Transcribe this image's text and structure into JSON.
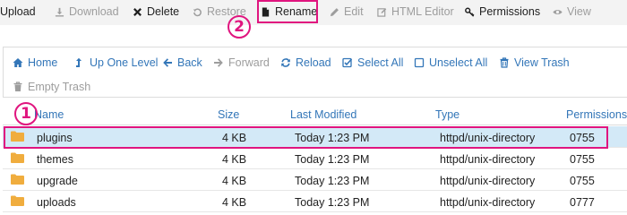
{
  "toolbar": {
    "upload": "Upload",
    "download": "Download",
    "delete": "Delete",
    "restore": "Restore",
    "rename": "Rename",
    "edit": "Edit",
    "html_editor": "HTML Editor",
    "permissions": "Permissions",
    "view": "View"
  },
  "nav": {
    "home": "Home",
    "up_one_level": "Up One Level",
    "back": "Back",
    "forward": "Forward",
    "reload": "Reload",
    "select_all": "Select All",
    "unselect_all": "Unselect All",
    "view_trash": "View Trash",
    "empty_trash": "Empty Trash"
  },
  "callouts": {
    "one": "1",
    "two": "2"
  },
  "table": {
    "headers": {
      "name": "Name",
      "size": "Size",
      "last_modified": "Last Modified",
      "type": "Type",
      "permissions": "Permissions"
    },
    "rows": [
      {
        "name": "plugins",
        "size": "4 KB",
        "modified": "Today 1:23 PM",
        "type": "httpd/unix-directory",
        "perms": "0755"
      },
      {
        "name": "themes",
        "size": "4 KB",
        "modified": "Today 1:23 PM",
        "type": "httpd/unix-directory",
        "perms": "0755"
      },
      {
        "name": "upgrade",
        "size": "4 KB",
        "modified": "Today 1:23 PM",
        "type": "httpd/unix-directory",
        "perms": "0755"
      },
      {
        "name": "uploads",
        "size": "4 KB",
        "modified": "Today 1:23 PM",
        "type": "httpd/unix-directory",
        "perms": "0777"
      }
    ]
  },
  "colors": {
    "accent": "#3376b8",
    "annotation": "#e0157f",
    "selected_row": "#d3e9f7",
    "folder": "#f0ad3e"
  }
}
